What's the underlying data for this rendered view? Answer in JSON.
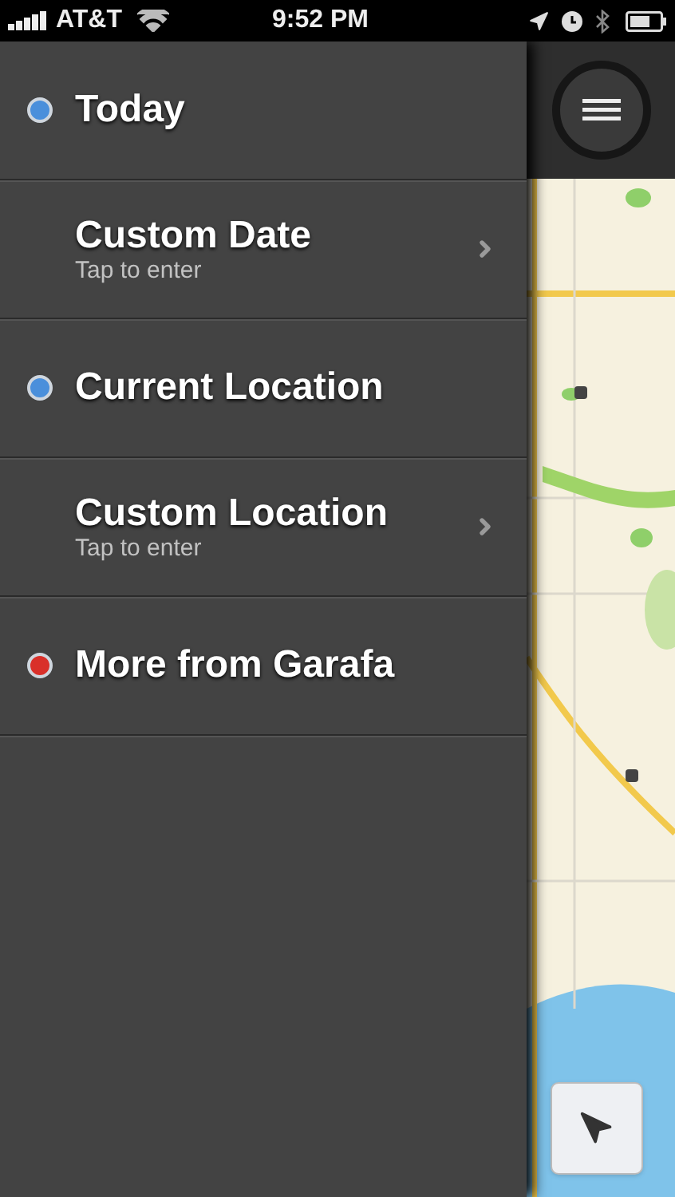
{
  "status_bar": {
    "carrier": "AT&T",
    "time": "9:52 PM"
  },
  "menu": [
    {
      "title": "Today",
      "color": "#4a8fdb",
      "disclosure": false
    },
    {
      "title": "Custom Date",
      "subtitle": "Tap to enter",
      "disclosure": true
    },
    {
      "title": "Current Location",
      "color": "#4a8fdb",
      "disclosure": false
    },
    {
      "title": "Custom Location",
      "subtitle": "Tap to enter",
      "disclosure": true
    },
    {
      "title": "More from Garafa",
      "color": "#d9302a",
      "disclosure": false
    }
  ]
}
